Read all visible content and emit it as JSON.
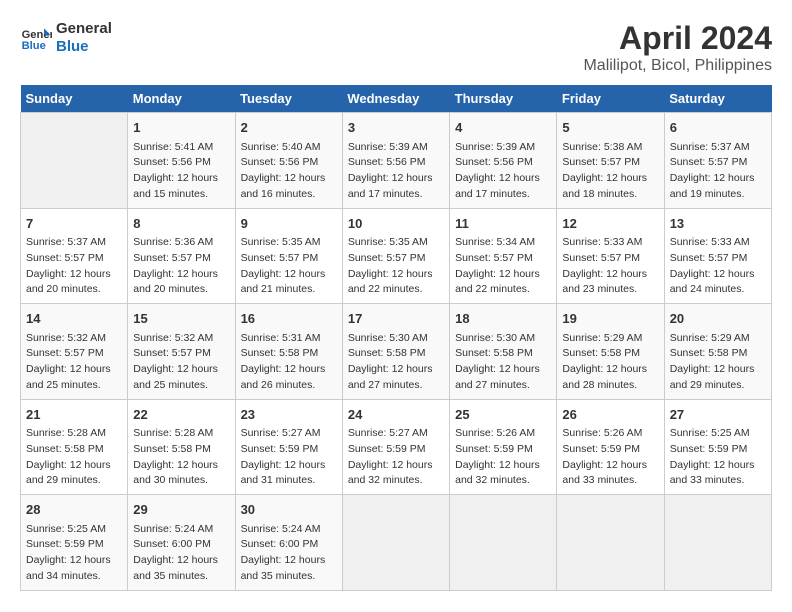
{
  "logo": {
    "line1": "General",
    "line2": "Blue"
  },
  "title": "April 2024",
  "subtitle": "Malilipot, Bicol, Philippines",
  "days": [
    "Sunday",
    "Monday",
    "Tuesday",
    "Wednesday",
    "Thursday",
    "Friday",
    "Saturday"
  ],
  "weeks": [
    [
      {
        "date": "",
        "info": ""
      },
      {
        "date": "1",
        "info": "Sunrise: 5:41 AM\nSunset: 5:56 PM\nDaylight: 12 hours\nand 15 minutes."
      },
      {
        "date": "2",
        "info": "Sunrise: 5:40 AM\nSunset: 5:56 PM\nDaylight: 12 hours\nand 16 minutes."
      },
      {
        "date": "3",
        "info": "Sunrise: 5:39 AM\nSunset: 5:56 PM\nDaylight: 12 hours\nand 17 minutes."
      },
      {
        "date": "4",
        "info": "Sunrise: 5:39 AM\nSunset: 5:56 PM\nDaylight: 12 hours\nand 17 minutes."
      },
      {
        "date": "5",
        "info": "Sunrise: 5:38 AM\nSunset: 5:57 PM\nDaylight: 12 hours\nand 18 minutes."
      },
      {
        "date": "6",
        "info": "Sunrise: 5:37 AM\nSunset: 5:57 PM\nDaylight: 12 hours\nand 19 minutes."
      }
    ],
    [
      {
        "date": "7",
        "info": "Sunrise: 5:37 AM\nSunset: 5:57 PM\nDaylight: 12 hours\nand 20 minutes."
      },
      {
        "date": "8",
        "info": "Sunrise: 5:36 AM\nSunset: 5:57 PM\nDaylight: 12 hours\nand 20 minutes."
      },
      {
        "date": "9",
        "info": "Sunrise: 5:35 AM\nSunset: 5:57 PM\nDaylight: 12 hours\nand 21 minutes."
      },
      {
        "date": "10",
        "info": "Sunrise: 5:35 AM\nSunset: 5:57 PM\nDaylight: 12 hours\nand 22 minutes."
      },
      {
        "date": "11",
        "info": "Sunrise: 5:34 AM\nSunset: 5:57 PM\nDaylight: 12 hours\nand 22 minutes."
      },
      {
        "date": "12",
        "info": "Sunrise: 5:33 AM\nSunset: 5:57 PM\nDaylight: 12 hours\nand 23 minutes."
      },
      {
        "date": "13",
        "info": "Sunrise: 5:33 AM\nSunset: 5:57 PM\nDaylight: 12 hours\nand 24 minutes."
      }
    ],
    [
      {
        "date": "14",
        "info": "Sunrise: 5:32 AM\nSunset: 5:57 PM\nDaylight: 12 hours\nand 25 minutes."
      },
      {
        "date": "15",
        "info": "Sunrise: 5:32 AM\nSunset: 5:57 PM\nDaylight: 12 hours\nand 25 minutes."
      },
      {
        "date": "16",
        "info": "Sunrise: 5:31 AM\nSunset: 5:58 PM\nDaylight: 12 hours\nand 26 minutes."
      },
      {
        "date": "17",
        "info": "Sunrise: 5:30 AM\nSunset: 5:58 PM\nDaylight: 12 hours\nand 27 minutes."
      },
      {
        "date": "18",
        "info": "Sunrise: 5:30 AM\nSunset: 5:58 PM\nDaylight: 12 hours\nand 27 minutes."
      },
      {
        "date": "19",
        "info": "Sunrise: 5:29 AM\nSunset: 5:58 PM\nDaylight: 12 hours\nand 28 minutes."
      },
      {
        "date": "20",
        "info": "Sunrise: 5:29 AM\nSunset: 5:58 PM\nDaylight: 12 hours\nand 29 minutes."
      }
    ],
    [
      {
        "date": "21",
        "info": "Sunrise: 5:28 AM\nSunset: 5:58 PM\nDaylight: 12 hours\nand 29 minutes."
      },
      {
        "date": "22",
        "info": "Sunrise: 5:28 AM\nSunset: 5:58 PM\nDaylight: 12 hours\nand 30 minutes."
      },
      {
        "date": "23",
        "info": "Sunrise: 5:27 AM\nSunset: 5:59 PM\nDaylight: 12 hours\nand 31 minutes."
      },
      {
        "date": "24",
        "info": "Sunrise: 5:27 AM\nSunset: 5:59 PM\nDaylight: 12 hours\nand 32 minutes."
      },
      {
        "date": "25",
        "info": "Sunrise: 5:26 AM\nSunset: 5:59 PM\nDaylight: 12 hours\nand 32 minutes."
      },
      {
        "date": "26",
        "info": "Sunrise: 5:26 AM\nSunset: 5:59 PM\nDaylight: 12 hours\nand 33 minutes."
      },
      {
        "date": "27",
        "info": "Sunrise: 5:25 AM\nSunset: 5:59 PM\nDaylight: 12 hours\nand 33 minutes."
      }
    ],
    [
      {
        "date": "28",
        "info": "Sunrise: 5:25 AM\nSunset: 5:59 PM\nDaylight: 12 hours\nand 34 minutes."
      },
      {
        "date": "29",
        "info": "Sunrise: 5:24 AM\nSunset: 6:00 PM\nDaylight: 12 hours\nand 35 minutes."
      },
      {
        "date": "30",
        "info": "Sunrise: 5:24 AM\nSunset: 6:00 PM\nDaylight: 12 hours\nand 35 minutes."
      },
      {
        "date": "",
        "info": ""
      },
      {
        "date": "",
        "info": ""
      },
      {
        "date": "",
        "info": ""
      },
      {
        "date": "",
        "info": ""
      }
    ]
  ]
}
